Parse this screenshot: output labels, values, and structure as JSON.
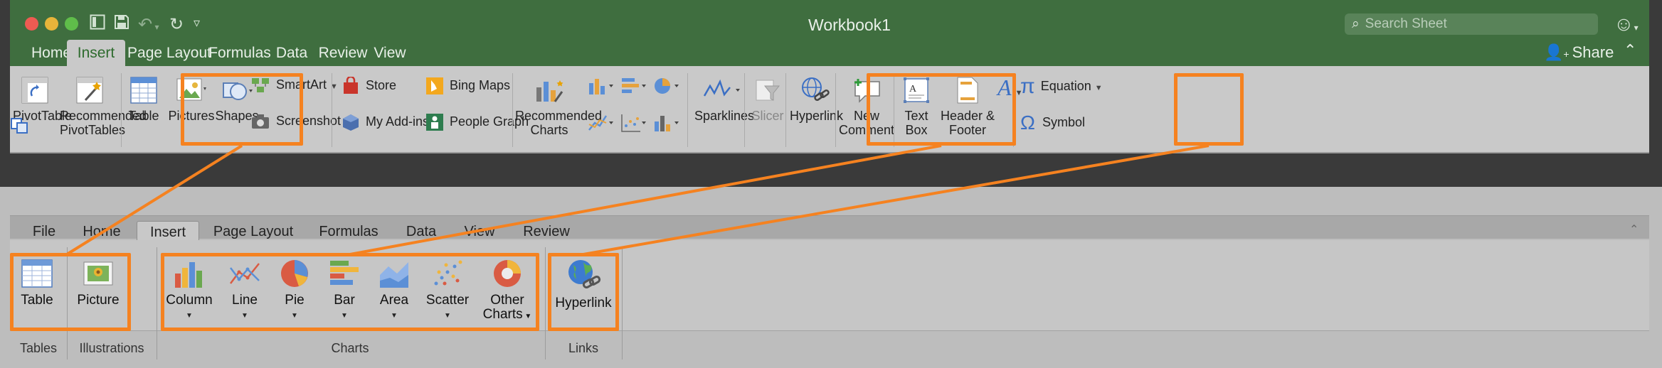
{
  "top": {
    "window_title": "Workbook1",
    "search_placeholder": "Search Sheet",
    "tabs": [
      "Home",
      "Insert",
      "Page Layout",
      "Formulas",
      "Data",
      "Review",
      "View"
    ],
    "share_label": "Share",
    "ribbon": {
      "pivot_table": "PivotTable",
      "recommended_pivot_1": "Recommended",
      "recommended_pivot_2": "PivotTables",
      "table": "Table",
      "pictures": "Pictures",
      "shapes": "Shapes",
      "smartart": "SmartArt",
      "screenshot": "Screenshot",
      "store": "Store",
      "my_addins": "My Add-ins",
      "bing_maps": "Bing Maps",
      "people_graph": "People Graph",
      "recommended_charts_1": "Recommended",
      "recommended_charts_2": "Charts",
      "sparklines": "Sparklines",
      "slicer": "Slicer",
      "hyperlink": "Hyperlink",
      "new_comment_1": "New",
      "new_comment_2": "Comment",
      "text_box_1": "Text",
      "text_box_2": "Box",
      "header_footer_1": "Header &",
      "header_footer_2": "Footer",
      "equation": "Equation",
      "symbol": "Symbol"
    }
  },
  "bottom": {
    "tabs": [
      "File",
      "Home",
      "Insert",
      "Page Layout",
      "Formulas",
      "Data",
      "View",
      "Review"
    ],
    "buttons": {
      "table": "Table",
      "picture": "Picture",
      "column": "Column",
      "line": "Line",
      "pie": "Pie",
      "bar": "Bar",
      "area": "Area",
      "scatter": "Scatter",
      "other_charts_1": "Other",
      "other_charts_2": "Charts",
      "hyperlink": "Hyperlink"
    },
    "groups": {
      "tables": "Tables",
      "illustrations": "Illustrations",
      "charts": "Charts",
      "links": "Links"
    }
  },
  "colors": {
    "highlight": "#f58220",
    "titlebar_green": "#3f6e3f",
    "ribbon_top": "#c9c9c9",
    "ribbon_bottom": "#c6c6c6"
  }
}
